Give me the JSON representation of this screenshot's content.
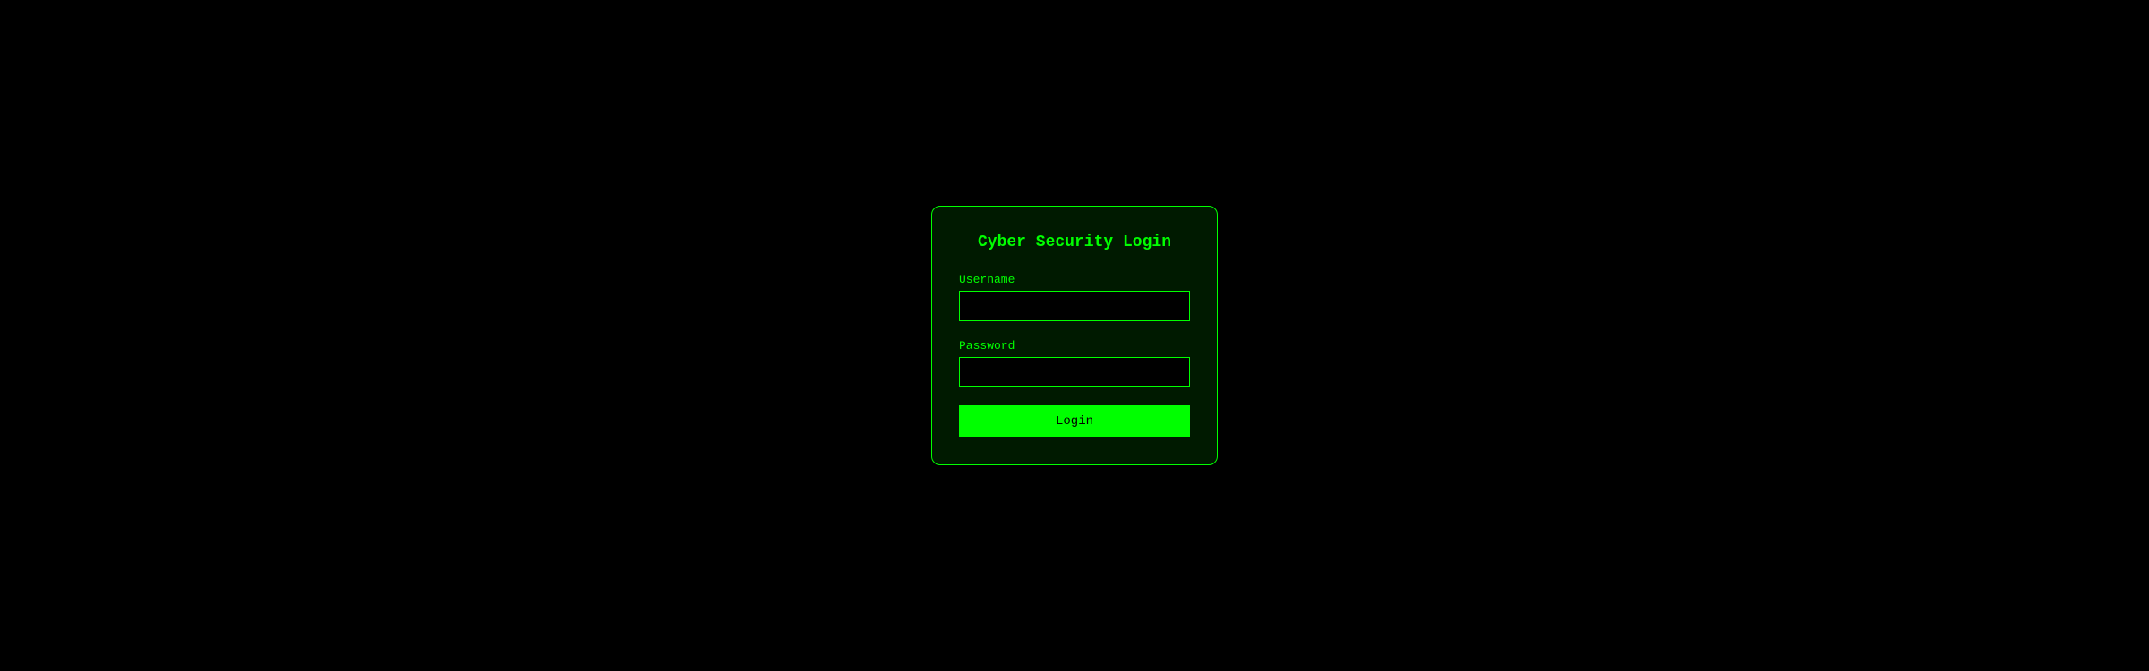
{
  "login": {
    "title": "Cyber Security Login",
    "username_label": "Username",
    "username_value": "",
    "password_label": "Password",
    "password_value": "",
    "submit_label": "Login"
  }
}
